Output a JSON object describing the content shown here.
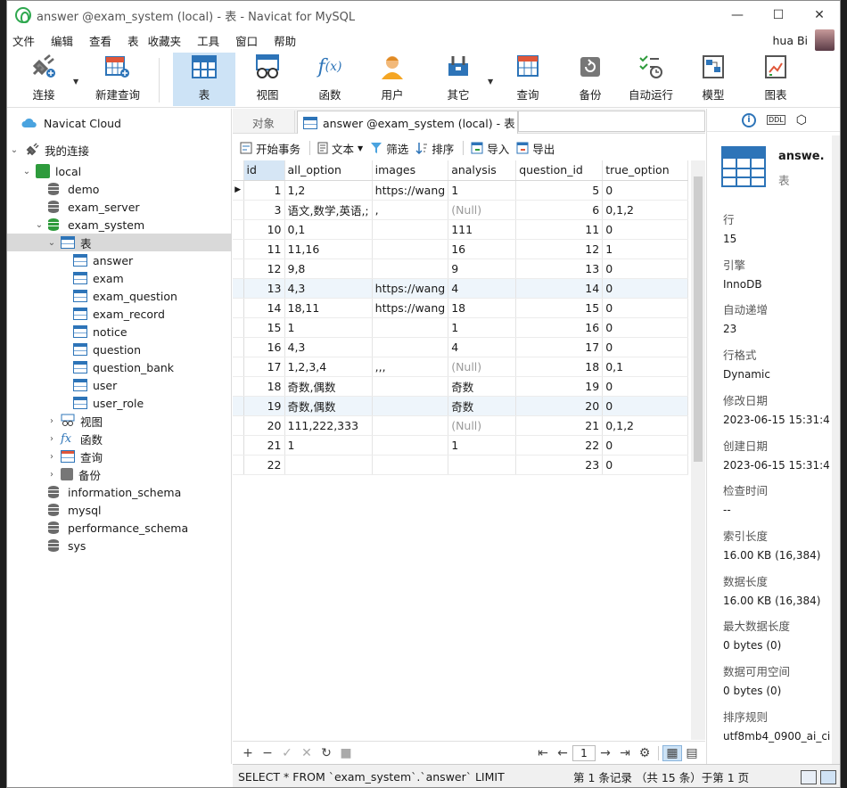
{
  "window": {
    "title": "answer @exam_system (local) - 表 - Navicat for MySQL",
    "minimize": "—",
    "maximize": "☐",
    "close": "✕"
  },
  "menu": [
    "文件",
    "编辑",
    "查看",
    "表",
    "收藏夹",
    "工具",
    "窗口",
    "帮助"
  ],
  "user": {
    "name": "hua Bi"
  },
  "toolbar": [
    {
      "label": "连接",
      "icon": "connection-icon",
      "has_dropdown": true
    },
    {
      "label": "新建查询",
      "icon": "new-query-icon"
    },
    {
      "label": "表",
      "icon": "table-icon",
      "active": true
    },
    {
      "label": "视图",
      "icon": "view-icon"
    },
    {
      "label": "函数",
      "icon": "function-icon"
    },
    {
      "label": "用户",
      "icon": "user-icon"
    },
    {
      "label": "其它",
      "icon": "tools-icon",
      "has_dropdown": true
    },
    {
      "label": "查询",
      "icon": "query-icon"
    },
    {
      "label": "备份",
      "icon": "backup-icon"
    },
    {
      "label": "自动运行",
      "icon": "automation-icon"
    },
    {
      "label": "模型",
      "icon": "model-icon"
    },
    {
      "label": "图表",
      "icon": "chart-icon"
    }
  ],
  "tree": {
    "cloud": "Navicat Cloud",
    "my_connections": "我的连接",
    "connection": "local",
    "databases_before": [
      "demo",
      "exam_server"
    ],
    "active_db": "exam_system",
    "tables_group": "表",
    "tables": [
      "answer",
      "exam",
      "exam_question",
      "exam_record",
      "notice",
      "question",
      "question_bank",
      "user",
      "user_role"
    ],
    "groups": [
      "视图",
      "函数",
      "查询",
      "备份"
    ],
    "databases_after": [
      "information_schema",
      "mysql",
      "performance_schema",
      "sys"
    ]
  },
  "tabs": {
    "objects": "对象",
    "current": "answer @exam_system (local) - 表"
  },
  "subtoolbar": {
    "begin_tx": "开始事务",
    "text": "文本",
    "filter": "筛选",
    "sort": "排序",
    "import": "导入",
    "export": "导出"
  },
  "grid": {
    "columns": [
      "id",
      "all_option",
      "images",
      "analysis",
      "question_id",
      "true_option"
    ],
    "rows": [
      [
        "1",
        "1,2",
        "https://wang",
        "1",
        "5",
        "0"
      ],
      [
        "3",
        "语文,数学,英语,;",
        ",",
        "(Null)",
        "6",
        "0,1,2"
      ],
      [
        "10",
        "0,1",
        "",
        "111",
        "11",
        "0"
      ],
      [
        "11",
        "11,16",
        "",
        "16",
        "12",
        "1"
      ],
      [
        "12",
        "9,8",
        "",
        "9",
        "13",
        "0"
      ],
      [
        "13",
        "4,3",
        "https://wang",
        "4",
        "14",
        "0"
      ],
      [
        "14",
        "18,11",
        "https://wang",
        "18",
        "15",
        "0"
      ],
      [
        "15",
        "1",
        "",
        "1",
        "16",
        "0"
      ],
      [
        "16",
        "4,3",
        "",
        "4",
        "17",
        "0"
      ],
      [
        "17",
        "1,2,3,4",
        ",,,",
        "(Null)",
        "18",
        "0,1"
      ],
      [
        "18",
        "奇数,偶数",
        "",
        "奇数",
        "19",
        "0"
      ],
      [
        "19",
        "奇数,偶数",
        "",
        "奇数",
        "20",
        "0"
      ],
      [
        "20",
        "111,222,333",
        "",
        "(Null)",
        "21",
        "0,1,2"
      ],
      [
        "21",
        "1",
        "",
        "1",
        "22",
        "0"
      ],
      [
        "22",
        "",
        "",
        "",
        "23",
        "0"
      ]
    ]
  },
  "pager": {
    "page": "1"
  },
  "status": {
    "sql": "SELECT * FROM `exam_system`.`answer` LIMIT 0,100",
    "records": "第 1 条记录 （共 15 条）于第 1 页"
  },
  "info": {
    "title": "answe.",
    "subtitle": "表",
    "props": [
      {
        "k": "行",
        "v": "15"
      },
      {
        "k": "引擎",
        "v": "InnoDB"
      },
      {
        "k": "自动递增",
        "v": "23"
      },
      {
        "k": "行格式",
        "v": "Dynamic"
      },
      {
        "k": "修改日期",
        "v": "2023-06-15 15:31:4"
      },
      {
        "k": "创建日期",
        "v": "2023-06-15 15:31:4"
      },
      {
        "k": "检查时间",
        "v": "--"
      },
      {
        "k": "索引长度",
        "v": "16.00 KB (16,384)"
      },
      {
        "k": "数据长度",
        "v": "16.00 KB (16,384)"
      },
      {
        "k": "最大数据长度",
        "v": "0 bytes (0)"
      },
      {
        "k": "数据可用空间",
        "v": "0 bytes (0)"
      },
      {
        "k": "排序规则",
        "v": "utf8mb4_0900_ai_ci"
      }
    ]
  }
}
